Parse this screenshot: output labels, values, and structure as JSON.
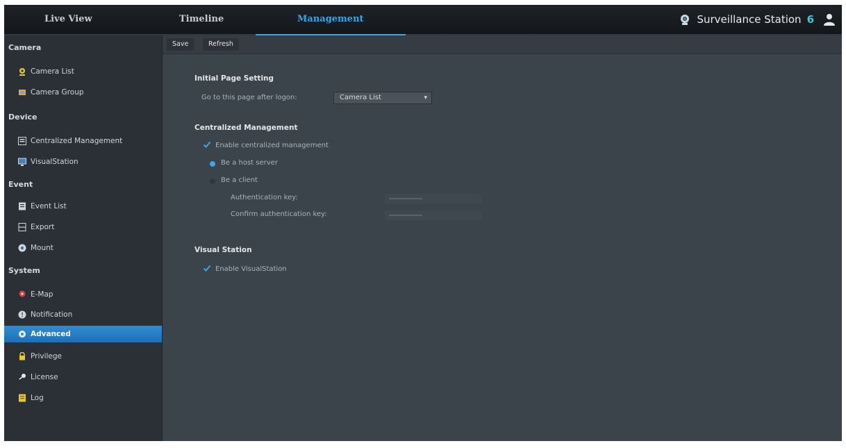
{
  "nav": {
    "tabs": [
      {
        "label": "Live View"
      },
      {
        "label": "Timeline"
      },
      {
        "label": "Management"
      }
    ],
    "brand": "Surveillance Station",
    "brand_version": "6"
  },
  "sidebar": {
    "sections": [
      {
        "title": "Camera"
      },
      {
        "title": "Device"
      },
      {
        "title": "Event"
      },
      {
        "title": "System"
      }
    ],
    "items": [
      {
        "label": "Camera List",
        "icon": "camera-icon"
      },
      {
        "label": "Camera Group",
        "icon": "camera-group-icon"
      },
      {
        "label": "Centralized Management",
        "icon": "centralized-management-icon"
      },
      {
        "label": "VisualStation",
        "icon": "visualstation-icon"
      },
      {
        "label": "Event List",
        "icon": "event-list-icon"
      },
      {
        "label": "Export",
        "icon": "export-icon"
      },
      {
        "label": "Mount",
        "icon": "mount-icon"
      },
      {
        "label": "E-Map",
        "icon": "emap-icon"
      },
      {
        "label": "Notification",
        "icon": "notification-icon"
      },
      {
        "label": "Advanced",
        "icon": "gear-icon",
        "active": true
      },
      {
        "label": "Privilege",
        "icon": "lock-icon"
      },
      {
        "label": "License",
        "icon": "key-icon"
      },
      {
        "label": "Log",
        "icon": "log-icon"
      }
    ]
  },
  "toolbar": {
    "save_label": "Save",
    "refresh_label": "Refresh"
  },
  "content": {
    "initial_page": {
      "heading": "Initial Page Setting",
      "label": "Go to this page after logon:",
      "selected": "Camera List"
    },
    "centralized": {
      "heading": "Centralized Management",
      "enable_label": "Enable centralized management",
      "enable_checked": true,
      "host_label": "Be a host server",
      "host_selected": true,
      "client_label": "Be a client",
      "auth_key_label": "Authentication key:",
      "confirm_key_label": "Confirm authentication key:"
    },
    "visual_station": {
      "heading": "Visual Station",
      "enable_label": "Enable VisualStation",
      "enable_checked": true
    }
  },
  "colors": {
    "accent": "#39a6e6",
    "active_item": "#2f8dd3",
    "background": "#3b434b"
  }
}
